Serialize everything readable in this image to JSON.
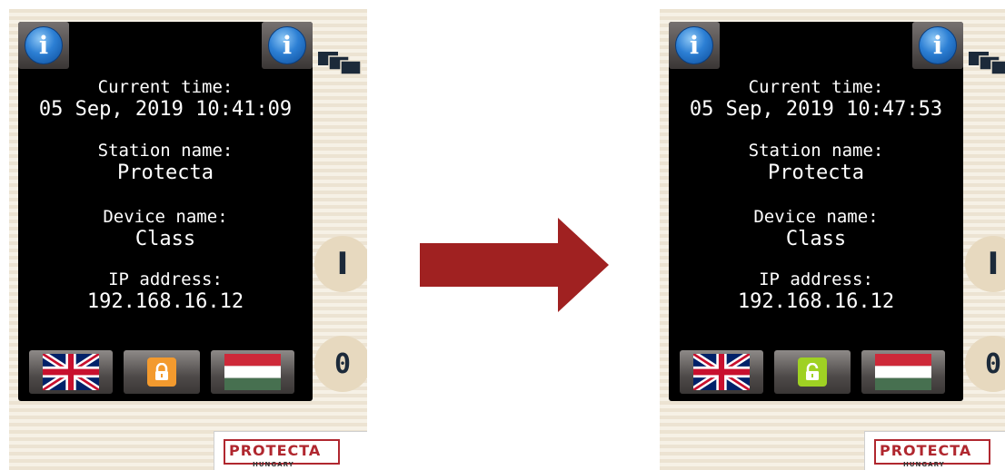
{
  "panels": [
    {
      "current_time_label": "Current time:",
      "current_time_value": "05 Sep, 2019 10:41:09",
      "station_name_label": "Station name:",
      "station_name_value": "Protecta",
      "device_name_label": "Device name:",
      "device_name_value": "Class",
      "ip_address_label": "IP address:",
      "ip_address_value": "192.168.16.12",
      "lock_state": "locked",
      "lock_color": "#f39a2e",
      "info_icon_glyph": "i",
      "on_button_glyph": "I",
      "off_button_glyph": "0"
    },
    {
      "current_time_label": "Current time:",
      "current_time_value": "05 Sep, 2019 10:47:53",
      "station_name_label": "Station name:",
      "station_name_value": "Protecta",
      "device_name_label": "Device name:",
      "device_name_value": "Class",
      "ip_address_label": "IP address:",
      "ip_address_value": "192.168.16.12",
      "lock_state": "unlocked",
      "lock_color": "#9fd123",
      "info_icon_glyph": "i",
      "on_button_glyph": "I",
      "off_button_glyph": "0"
    }
  ],
  "logo": {
    "brand": "PROTECTA",
    "sub": "HUNGARY",
    "color": "#b0272f"
  },
  "arrow_color": "#a02121"
}
